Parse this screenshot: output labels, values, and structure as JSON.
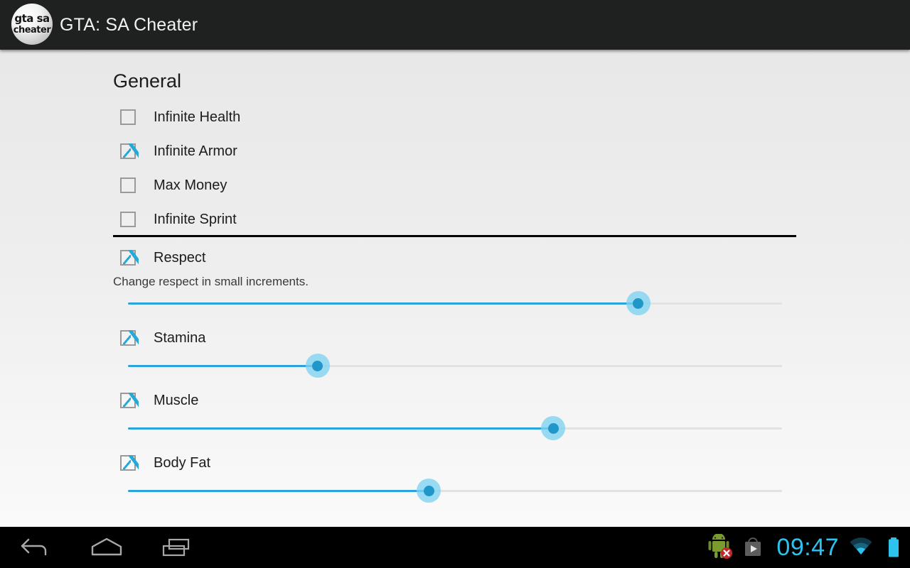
{
  "app": {
    "title": "GTA: SA Cheater",
    "logo_line1": "gta sa",
    "logo_line2": "cheater",
    "accent_color": "#2ca3dd",
    "titlebar_color": "#1f2020"
  },
  "main": {
    "section_title": "General",
    "checkboxes": [
      {
        "label": "Infinite Health",
        "checked": false
      },
      {
        "label": "Infinite Armor",
        "checked": true
      },
      {
        "label": "Max Money",
        "checked": false
      },
      {
        "label": "Infinite Sprint",
        "checked": false
      }
    ],
    "sliders": [
      {
        "label": "Respect",
        "checked": true,
        "subtitle": "Change respect in small increments.",
        "value_percent": 78
      },
      {
        "label": "Stamina",
        "checked": true,
        "subtitle": "",
        "value_percent": 29
      },
      {
        "label": "Muscle",
        "checked": true,
        "subtitle": "",
        "value_percent": 65
      },
      {
        "label": "Body Fat",
        "checked": true,
        "subtitle": "",
        "value_percent": 46
      }
    ]
  },
  "navbar": {
    "back_label": "Back",
    "home_label": "Home",
    "recents_label": "Recent apps",
    "clock": "09:47",
    "icons": {
      "android_warning": "android-robot-error-icon",
      "play_store": "play-store-icon",
      "wifi": "wifi-icon",
      "battery": "battery-full-icon"
    },
    "clock_color": "#2ec2ef"
  }
}
